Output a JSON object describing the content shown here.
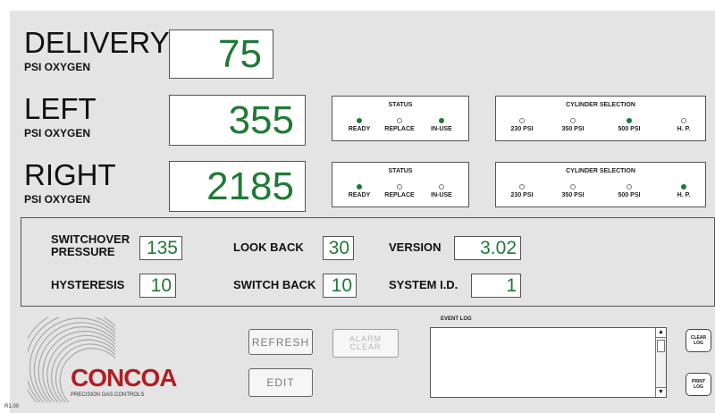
{
  "delivery": {
    "title": "DELIVERY",
    "subtitle": "PSI OXYGEN",
    "value": "75"
  },
  "left": {
    "title": "LEFT",
    "subtitle": "PSI OXYGEN",
    "value": "355",
    "status": {
      "title": "STATUS",
      "indicators": [
        {
          "label": "READY",
          "on": true
        },
        {
          "label": "REPLACE",
          "on": false
        },
        {
          "label": "IN-USE",
          "on": true
        }
      ]
    },
    "cylinder": {
      "title": "CYLINDER SELECTION",
      "options": [
        {
          "label": "230 PSI",
          "on": false
        },
        {
          "label": "350 PSI",
          "on": false
        },
        {
          "label": "500 PSI",
          "on": true
        },
        {
          "label": "H. P.",
          "on": false
        }
      ]
    }
  },
  "right": {
    "title": "RIGHT",
    "subtitle": "PSI OXYGEN",
    "value": "2185",
    "status": {
      "title": "STATUS",
      "indicators": [
        {
          "label": "READY",
          "on": true
        },
        {
          "label": "REPLACE",
          "on": false
        },
        {
          "label": "IN-USE",
          "on": false
        }
      ]
    },
    "cylinder": {
      "title": "CYLINDER SELECTION",
      "options": [
        {
          "label": "230 PSI",
          "on": false
        },
        {
          "label": "350 PSI",
          "on": false
        },
        {
          "label": "500 PSI",
          "on": false
        },
        {
          "label": "H. P.",
          "on": true
        }
      ]
    }
  },
  "settings": {
    "switchover_label_1": "SWITCHOVER",
    "switchover_label_2": "PRESSURE",
    "switchover_value": "135",
    "lookback_label": "LOOK BACK",
    "lookback_value": "30",
    "version_label": "VERSION",
    "version_value": "3.02",
    "hysteresis_label": "HYSTERESIS",
    "hysteresis_value": "10",
    "switchback_label": "SWITCH BACK",
    "switchback_value": "10",
    "systemid_label": "SYSTEM I.D.",
    "systemid_value": "1"
  },
  "buttons": {
    "refresh": "REFRESH",
    "alarm_clear_1": "ALARM",
    "alarm_clear_2": "CLEAR",
    "edit": "EDIT",
    "clear_log_1": "CLEAR",
    "clear_log_2": "LOG",
    "print_log_1": "PRINT",
    "print_log_2": "LOG"
  },
  "event_log": {
    "title": "EVENT LOG"
  },
  "logo": {
    "brand": "CONCOA",
    "tagline": "PRECISION GAS CONTROLS"
  },
  "revision": "R1.00",
  "colors": {
    "led_on": "#1f7a36",
    "value_text": "#1f7a36",
    "panel": "#e4e4e4",
    "logo_red": "#b01e23"
  }
}
